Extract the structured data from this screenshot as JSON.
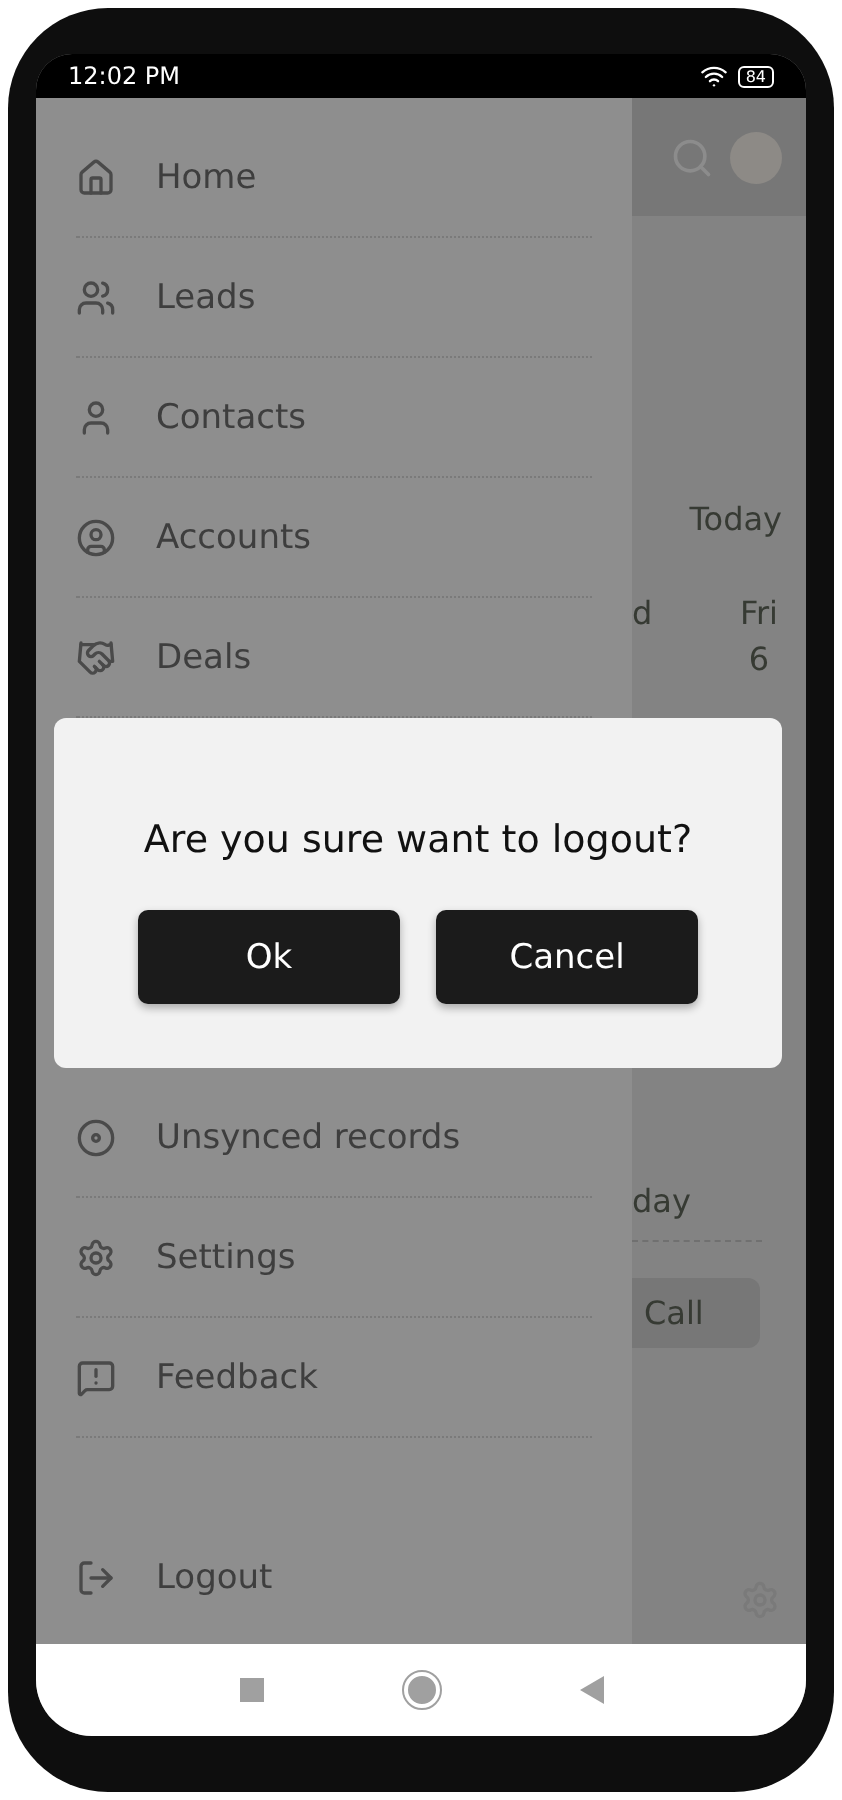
{
  "status_bar": {
    "time": "12:02 PM",
    "battery": "84"
  },
  "drawer": {
    "items": [
      {
        "label": "Home"
      },
      {
        "label": "Leads"
      },
      {
        "label": "Contacts"
      },
      {
        "label": "Accounts"
      },
      {
        "label": "Deals"
      },
      {
        "label": "Unsynced records"
      },
      {
        "label": "Settings"
      },
      {
        "label": "Feedback"
      }
    ],
    "logout": "Logout"
  },
  "background": {
    "today": "Today",
    "day_col": "d",
    "fri": "Fri",
    "date": "6",
    "day": "day",
    "call": "Call"
  },
  "dialog": {
    "message": "Are you sure want to logout?",
    "buttons": [
      "Ok",
      "Cancel"
    ]
  }
}
